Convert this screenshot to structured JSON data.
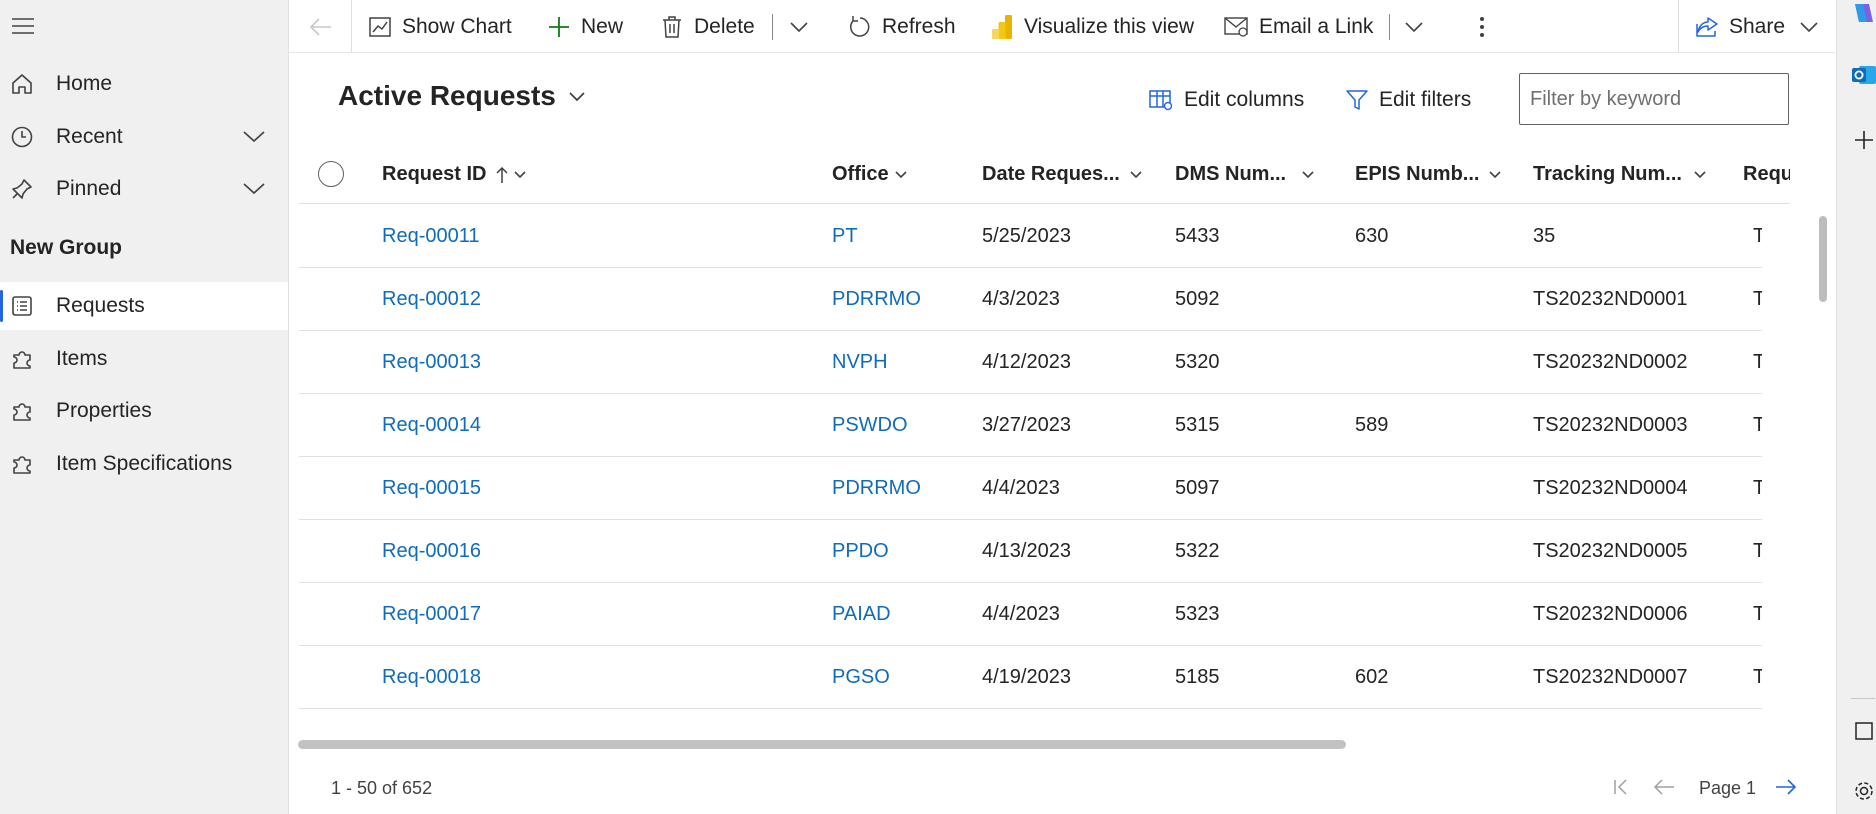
{
  "sidebar": {
    "items": [
      {
        "label": "Home",
        "icon": "home-icon"
      },
      {
        "label": "Recent",
        "icon": "clock-icon"
      },
      {
        "label": "Pinned",
        "icon": "pin-icon"
      }
    ],
    "group_title": "New Group",
    "group_items": [
      {
        "label": "Requests",
        "icon": "list-icon",
        "active": true
      },
      {
        "label": "Items",
        "icon": "puzzle-icon"
      },
      {
        "label": "Properties",
        "icon": "puzzle-icon"
      },
      {
        "label": "Item Specifications",
        "icon": "puzzle-icon"
      }
    ]
  },
  "commandbar": {
    "show_chart": "Show Chart",
    "new": "New",
    "delete": "Delete",
    "refresh": "Refresh",
    "visualize": "Visualize this view",
    "email_link": "Email a Link",
    "share": "Share"
  },
  "view": {
    "title": "Active Requests",
    "edit_columns": "Edit columns",
    "edit_filters": "Edit filters",
    "filter_placeholder": "Filter by keyword"
  },
  "grid": {
    "columns": [
      "Request ID",
      "Office",
      "Date Reques...",
      "DMS Num...",
      "EPIS Numb...",
      "Tracking Num...",
      "Requ"
    ],
    "rows": [
      {
        "id": "Req-00011",
        "office": "PT",
        "date": "5/25/2023",
        "dms": "5433",
        "epis": "630",
        "tracking": "35",
        "req": "T"
      },
      {
        "id": "Req-00012",
        "office": "PDRRMO",
        "date": "4/3/2023",
        "dms": "5092",
        "epis": "",
        "tracking": "TS20232ND0001",
        "req": "T"
      },
      {
        "id": "Req-00013",
        "office": "NVPH",
        "date": "4/12/2023",
        "dms": "5320",
        "epis": "",
        "tracking": "TS20232ND0002",
        "req": "T"
      },
      {
        "id": "Req-00014",
        "office": "PSWDO",
        "date": "3/27/2023",
        "dms": "5315",
        "epis": "589",
        "tracking": "TS20232ND0003",
        "req": "T"
      },
      {
        "id": "Req-00015",
        "office": "PDRRMO",
        "date": "4/4/2023",
        "dms": "5097",
        "epis": "",
        "tracking": "TS20232ND0004",
        "req": "T"
      },
      {
        "id": "Req-00016",
        "office": "PPDO",
        "date": "4/13/2023",
        "dms": "5322",
        "epis": "",
        "tracking": "TS20232ND0005",
        "req": "T"
      },
      {
        "id": "Req-00017",
        "office": "PAIAD",
        "date": "4/4/2023",
        "dms": "5323",
        "epis": "",
        "tracking": "TS20232ND0006",
        "req": "T"
      },
      {
        "id": "Req-00018",
        "office": "PGSO",
        "date": "4/19/2023",
        "dms": "5185",
        "epis": "602",
        "tracking": "TS20232ND0007",
        "req": "T"
      }
    ]
  },
  "footer": {
    "count": "1 - 50 of 652",
    "page": "Page 1"
  },
  "colors": {
    "link": "#0f6cbd",
    "accent": "#2266e3",
    "sidebar_bg": "#f0f0f0"
  }
}
